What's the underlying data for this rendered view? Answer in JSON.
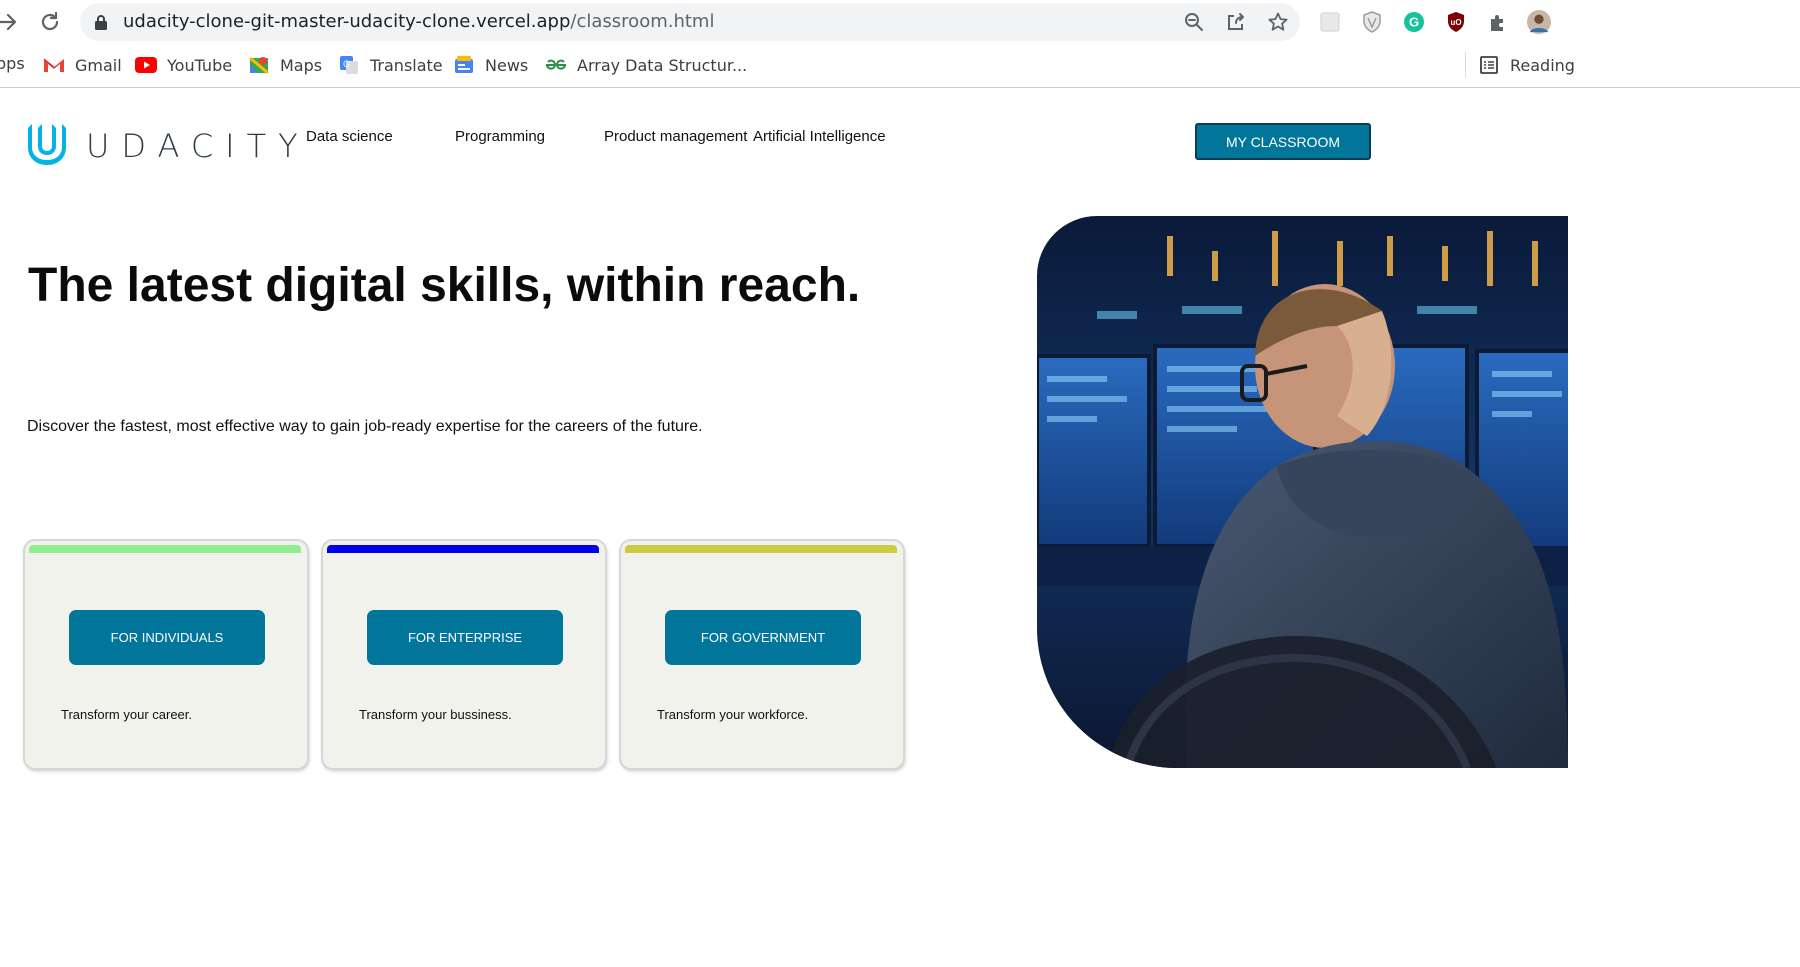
{
  "browser": {
    "url_host": "udacity-clone-git-master-udacity-clone.vercel.app",
    "url_path": "/classroom.html",
    "bookmarks": [
      {
        "label": "pps",
        "icon": "apps-icon"
      },
      {
        "label": "Gmail",
        "icon": "gmail-icon"
      },
      {
        "label": "YouTube",
        "icon": "youtube-icon"
      },
      {
        "label": "Maps",
        "icon": "maps-icon"
      },
      {
        "label": "Translate",
        "icon": "translate-icon"
      },
      {
        "label": "News",
        "icon": "news-icon"
      },
      {
        "label": "Array Data Structur...",
        "icon": "geeksforgeeks-icon"
      }
    ],
    "reading_list": "Reading"
  },
  "header": {
    "logo_text": "UDACITY",
    "nav": [
      "Data science",
      "Programming",
      "Product management",
      "Artificial Intelligence"
    ],
    "cta_label": "MY CLASSROOM"
  },
  "hero": {
    "title": "The latest digital skills, within reach.",
    "subtitle": "Discover the fastest, most effective way to gain job-ready expertise for the careers of the future."
  },
  "cards": [
    {
      "button": "FOR INDIVIDUALS",
      "text": "Transform your career.",
      "accent": "#90ee90"
    },
    {
      "button": "FOR ENTERPRISE",
      "text": "Transform your bussiness.",
      "accent": "#0000ee"
    },
    {
      "button": "FOR GOVERNMENT",
      "text": "Transform your workforce.",
      "accent": "#cccc44"
    }
  ],
  "colors": {
    "brand_teal": "#02769a",
    "logo_cyan": "#02b3e4",
    "card_bg": "#f2f2ec"
  }
}
